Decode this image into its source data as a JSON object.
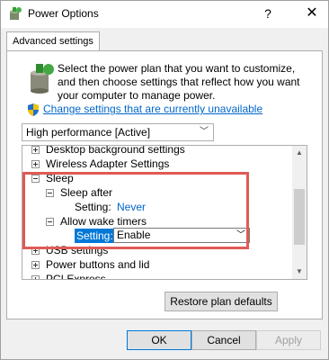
{
  "window": {
    "title": "Power Options",
    "help": "?",
    "close": "✕"
  },
  "tab": {
    "label": "Advanced settings"
  },
  "intro": {
    "text": "Select the power plan that you want to customize, and then choose settings that reflect how you want your computer to manage power.",
    "link": "Change settings that are currently unavailable"
  },
  "plan": {
    "selected": "High performance [Active]"
  },
  "tree": {
    "desktop_bg": "Desktop background settings",
    "wireless": "Wireless Adapter Settings",
    "sleep": "Sleep",
    "sleep_after": "Sleep after",
    "setting_label": "Setting:",
    "sleep_after_value": "Never",
    "wake_timers": "Allow wake timers",
    "wake_timers_value": "Enable",
    "usb": "USB settings",
    "power_buttons": "Power buttons and lid",
    "pci": "PCI Express"
  },
  "buttons": {
    "restore": "Restore plan defaults",
    "ok": "OK",
    "cancel": "Cancel",
    "apply": "Apply"
  },
  "colors": {
    "highlight": "#e05a55",
    "link": "#0066cc",
    "selection": "#0078d7"
  }
}
